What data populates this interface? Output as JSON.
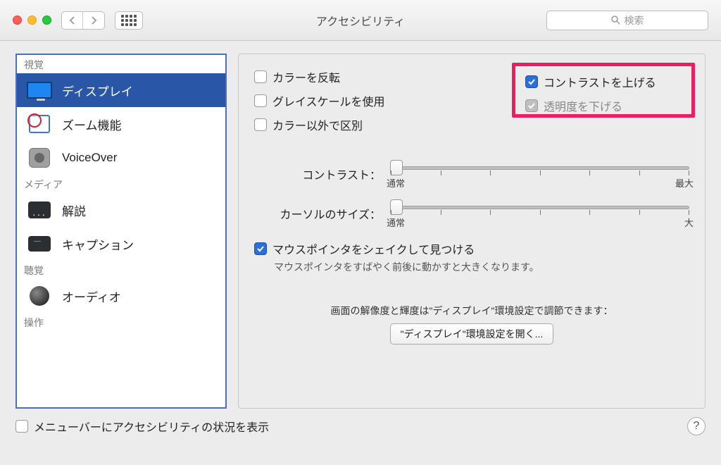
{
  "window": {
    "title": "アクセシビリティ"
  },
  "search": {
    "placeholder": "検索"
  },
  "sidebar": {
    "section_visual": "視覚",
    "section_media": "メディア",
    "section_hearing": "聴覚",
    "section_interaction": "操作",
    "items": {
      "display": "ディスプレイ",
      "zoom": "ズーム機能",
      "voiceover": "VoiceOver",
      "descriptions": "解説",
      "captions": "キャプション",
      "audio": "オーディオ"
    }
  },
  "panel": {
    "invert_colors": "カラーを反転",
    "use_grayscale": "グレイスケールを使用",
    "differentiate_without_color": "カラー以外で区別",
    "increase_contrast": "コントラストを上げる",
    "reduce_transparency": "透明度を下げる",
    "contrast_label": "コントラスト：",
    "contrast_min": "通常",
    "contrast_max": "最大",
    "cursor_size_label": "カーソルのサイズ：",
    "cursor_min": "通常",
    "cursor_max": "大",
    "shake_to_locate": "マウスポインタをシェイクして見つける",
    "shake_subtitle": "マウスポインタをすばやく前後に動かすと大きくなります。",
    "display_hint": "画面の解像度と輝度は\"ディスプレイ\"環境設定で調節できます：",
    "open_display_prefs": "\"ディスプレイ\"環境設定を開く..."
  },
  "footer": {
    "show_in_menubar": "メニューバーにアクセシビリティの状況を表示"
  }
}
